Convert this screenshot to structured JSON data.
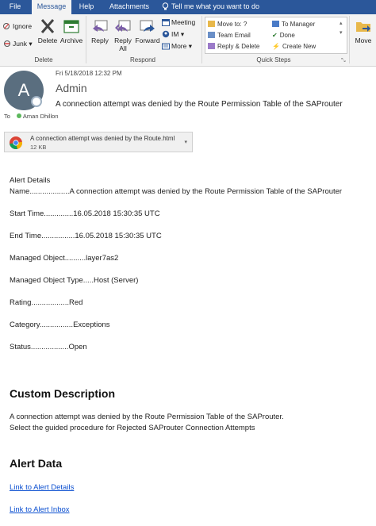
{
  "ribbon": {
    "tabs": [
      {
        "label": "File"
      },
      {
        "label": "Message"
      },
      {
        "label": "Help"
      },
      {
        "label": "Attachments"
      }
    ],
    "tell_me": "Tell me what you want to do",
    "delete_group": {
      "ignore": "Ignore",
      "junk": "Junk",
      "delete": "Delete",
      "archive": "Archive",
      "label": "Delete"
    },
    "respond_group": {
      "reply": "Reply",
      "reply_all_1": "Reply",
      "reply_all_2": "All",
      "forward": "Forward",
      "meeting": "Meeting",
      "im": "IM",
      "more": "More",
      "label": "Respond"
    },
    "quick_steps": {
      "move_to": "Move to: ?",
      "team_email": "Team Email",
      "reply_delete": "Reply & Delete",
      "to_manager": "To Manager",
      "done": "Done",
      "create_new": "Create New",
      "label": "Quick Steps"
    },
    "move_group": {
      "move": "Move"
    }
  },
  "message": {
    "avatar_initial": "A",
    "date": "Fri 5/18/2018 12:32 PM",
    "sender": "Admin",
    "subject": "A connection attempt was denied by the Route Permission Table of the SAProuter",
    "to_label": "To",
    "to_name": "Aman Dhillon"
  },
  "attachment": {
    "name": "A connection attempt was denied by the Route.html",
    "size": "12 KB"
  },
  "body": {
    "alert_details": "Alert Details",
    "name_line": "Name...................A connection attempt was denied by the Route Permission Table of the SAProuter",
    "start_time": "Start Time..............16.05.2018 15:30:35 UTC",
    "end_time": "End Time................16.05.2018 15:30:35 UTC",
    "managed_object": "Managed Object..........layer7as2",
    "managed_object_type": "Managed Object Type.....Host (Server)",
    "rating": "Rating..................Red",
    "category": "Category................Exceptions",
    "status": "Status..................Open",
    "custom_heading": "Custom Description",
    "custom_line1": "A connection attempt was denied by the Route Permission Table of the SAProuter.",
    "custom_line2": "Select the guided procedure for Rejected SAProuter Connection Attempts",
    "alert_data_heading": "Alert Data",
    "link_details": "Link to Alert Details",
    "link_inbox": "Link to Alert Inbox"
  },
  "colors": {
    "ribbon_blue": "#2b579a",
    "link": "#0b4fd0",
    "avatar": "#5a6e7f",
    "presence_green": "#5cb85c"
  }
}
